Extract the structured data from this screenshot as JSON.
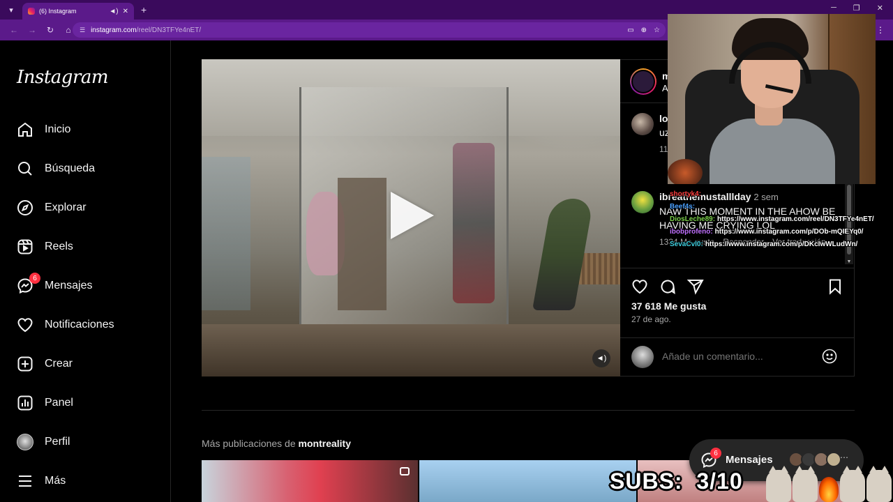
{
  "browser": {
    "tab_title": "(6) Instagram",
    "url_host": "instagram.com",
    "url_path": "/reel/DN3TFYe4nET/"
  },
  "sidebar": {
    "logo": "Instagram",
    "items": [
      {
        "label": "Inicio",
        "icon": "home-icon"
      },
      {
        "label": "Búsqueda",
        "icon": "search-icon"
      },
      {
        "label": "Explorar",
        "icon": "compass-icon"
      },
      {
        "label": "Reels",
        "icon": "reels-icon"
      },
      {
        "label": "Mensajes",
        "icon": "messenger-icon",
        "badge": "6"
      },
      {
        "label": "Notificaciones",
        "icon": "heart-icon"
      },
      {
        "label": "Crear",
        "icon": "plus-square-icon"
      },
      {
        "label": "Panel",
        "icon": "chart-icon"
      },
      {
        "label": "Perfil",
        "icon": "avatar"
      },
      {
        "label": "Más",
        "icon": "menu-icon"
      }
    ]
  },
  "post": {
    "header_user": "m",
    "header_sub": "A",
    "comments": [
      {
        "user": "lo",
        "text": "uz",
        "meta": "11"
      },
      {
        "user": "ibreathemustalllday",
        "time": "2 sem",
        "text": "NAW THIS MOMENT IN THE AHOW BE HAVING ME CRYING LOL",
        "likes": "1334 Me gusta",
        "reply": "Responder",
        "translate": "Ver traducción"
      }
    ],
    "likes": "37 618 Me gusta",
    "date": "27 de ago.",
    "comment_placeholder": "Añade un comentario..."
  },
  "more_posts": {
    "prefix": "Más publicaciones de",
    "account": "montreality"
  },
  "overlay": {
    "chat": [
      {
        "user": "shortyk4:",
        "msg": "",
        "color": "#ff4040"
      },
      {
        "user": "Beef4s:",
        "msg": "",
        "color": "#4aa0ff"
      },
      {
        "user": "DiosLeche89:",
        "msg": "https://www.instagram.com/reel/DN3TFYe4nET/",
        "color": "#7cd04a"
      },
      {
        "user": "ibobprofeno:",
        "msg": "https://www.instagram.com/p/DOb-mQIEYq0/",
        "color": "#c070ff"
      },
      {
        "user": "SevaCvl0:",
        "msg": "https://www.instagram.com/p/DKcIwWLudWn/",
        "color": "#40d0e0"
      }
    ],
    "messages_pill": {
      "label": "Mensajes",
      "badge": "6"
    },
    "subs": "SUBS:  3/10"
  }
}
